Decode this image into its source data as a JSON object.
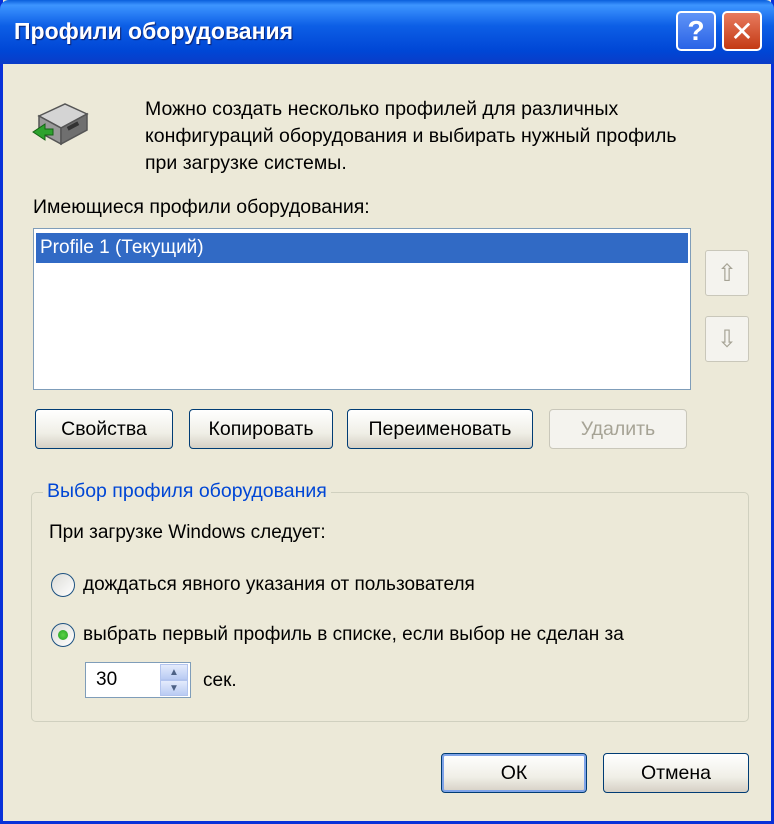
{
  "window": {
    "title": "Профили оборудования",
    "help_glyph": "?",
    "close_glyph": "✕"
  },
  "intro_text": "Можно создать несколько профилей для различных конфигураций оборудования и выбирать нужный профиль при загрузке системы.",
  "profiles": {
    "label": "Имеющиеся профили оборудования:",
    "items": [
      "Profile 1 (Текущий)"
    ],
    "move_up_glyph": "⇧",
    "move_down_glyph": "⇩"
  },
  "buttons": {
    "properties": "Свойства",
    "copy": "Копировать",
    "rename": "Переименовать",
    "delete": "Удалить",
    "ok": "ОК",
    "cancel": "Отмена"
  },
  "selection": {
    "legend": "Выбор профиля оборудования",
    "prompt": "При загрузке Windows следует:",
    "option_wait": "дождаться явного указания от пользователя",
    "option_select_first": "выбрать первый профиль в списке, если выбор не сделан за",
    "selected_option": "option_select_first",
    "timeout_value": "30",
    "timeout_unit": "сек."
  },
  "icons": {
    "hardware": "hardware-profile-icon"
  },
  "colors": {
    "titlebar": "#0046d5",
    "selection": "#316ac5",
    "group_legend": "#0046d5",
    "dialog_bg": "#ece9d8"
  }
}
